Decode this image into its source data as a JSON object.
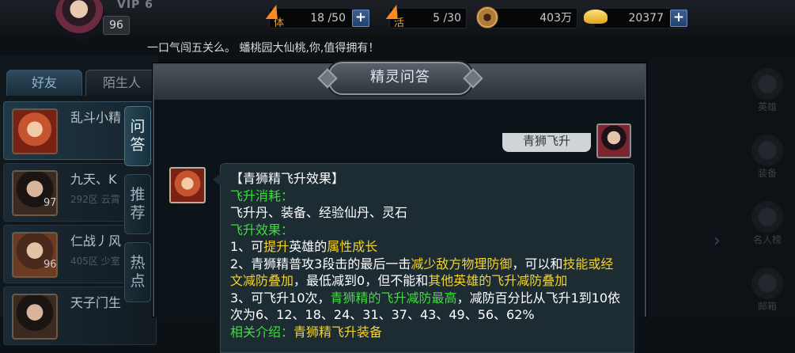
{
  "player": {
    "vip": "VIP 6",
    "level": "96"
  },
  "resources": {
    "stamina_icon_label": "体",
    "stamina": "18 /50",
    "activity_icon_label": "活",
    "activity": "5 /30",
    "coins": "403万",
    "ingots": "20377",
    "plus": "+"
  },
  "notice": "一口气闯五关么。 蟠桃园大仙桃,你,值得拥有！",
  "friends_panel": {
    "tabs": [
      "好友",
      "陌生人"
    ],
    "rows": [
      {
        "name": "乱斗小精",
        "sub": "",
        "level": ""
      },
      {
        "name": "九天、K",
        "sub": "292区 云霄",
        "level": "97"
      },
      {
        "name": "仁战丿风",
        "sub": "405区 少室",
        "level": "96"
      },
      {
        "name": "天子门生",
        "sub": "",
        "level": ""
      }
    ]
  },
  "side_tabs": [
    "问答",
    "推荐",
    "热点"
  ],
  "right_panel": {
    "items": [
      "英雄",
      "装备",
      "名人榜",
      "邮箱"
    ]
  },
  "dialog": {
    "title": "精灵问答",
    "my_message": "青狮飞升",
    "answer": {
      "heading": "【青狮精飞升效果】",
      "cost_label": "飞升消耗：",
      "cost_text": "飞升丹、装备、经验仙丹、灵石",
      "effect_label": "飞升效果：",
      "l1_a": "1、可",
      "l1_b": "提升",
      "l1_c": "英雄的",
      "l1_d": "属性成长",
      "l2_a": "2、青狮精普攻3段击的最后一击",
      "l2_b": "减少敌方物理防御",
      "l2_c": "，可以和",
      "l2_d": "技能或经文减防叠加",
      "l2_e": "，最低减到0，但不能和",
      "l2_f": "其他英雄的飞升减防叠加",
      "l3_a": "3、可飞升10次，",
      "l3_b": "青狮精的飞升减防最高",
      "l3_c": "，减防百分比从飞升1到10依次为6、12、18、24、31、37、43、49、56、62%",
      "related_label": "相关介绍：",
      "related_link": "青狮精飞升装备"
    }
  }
}
